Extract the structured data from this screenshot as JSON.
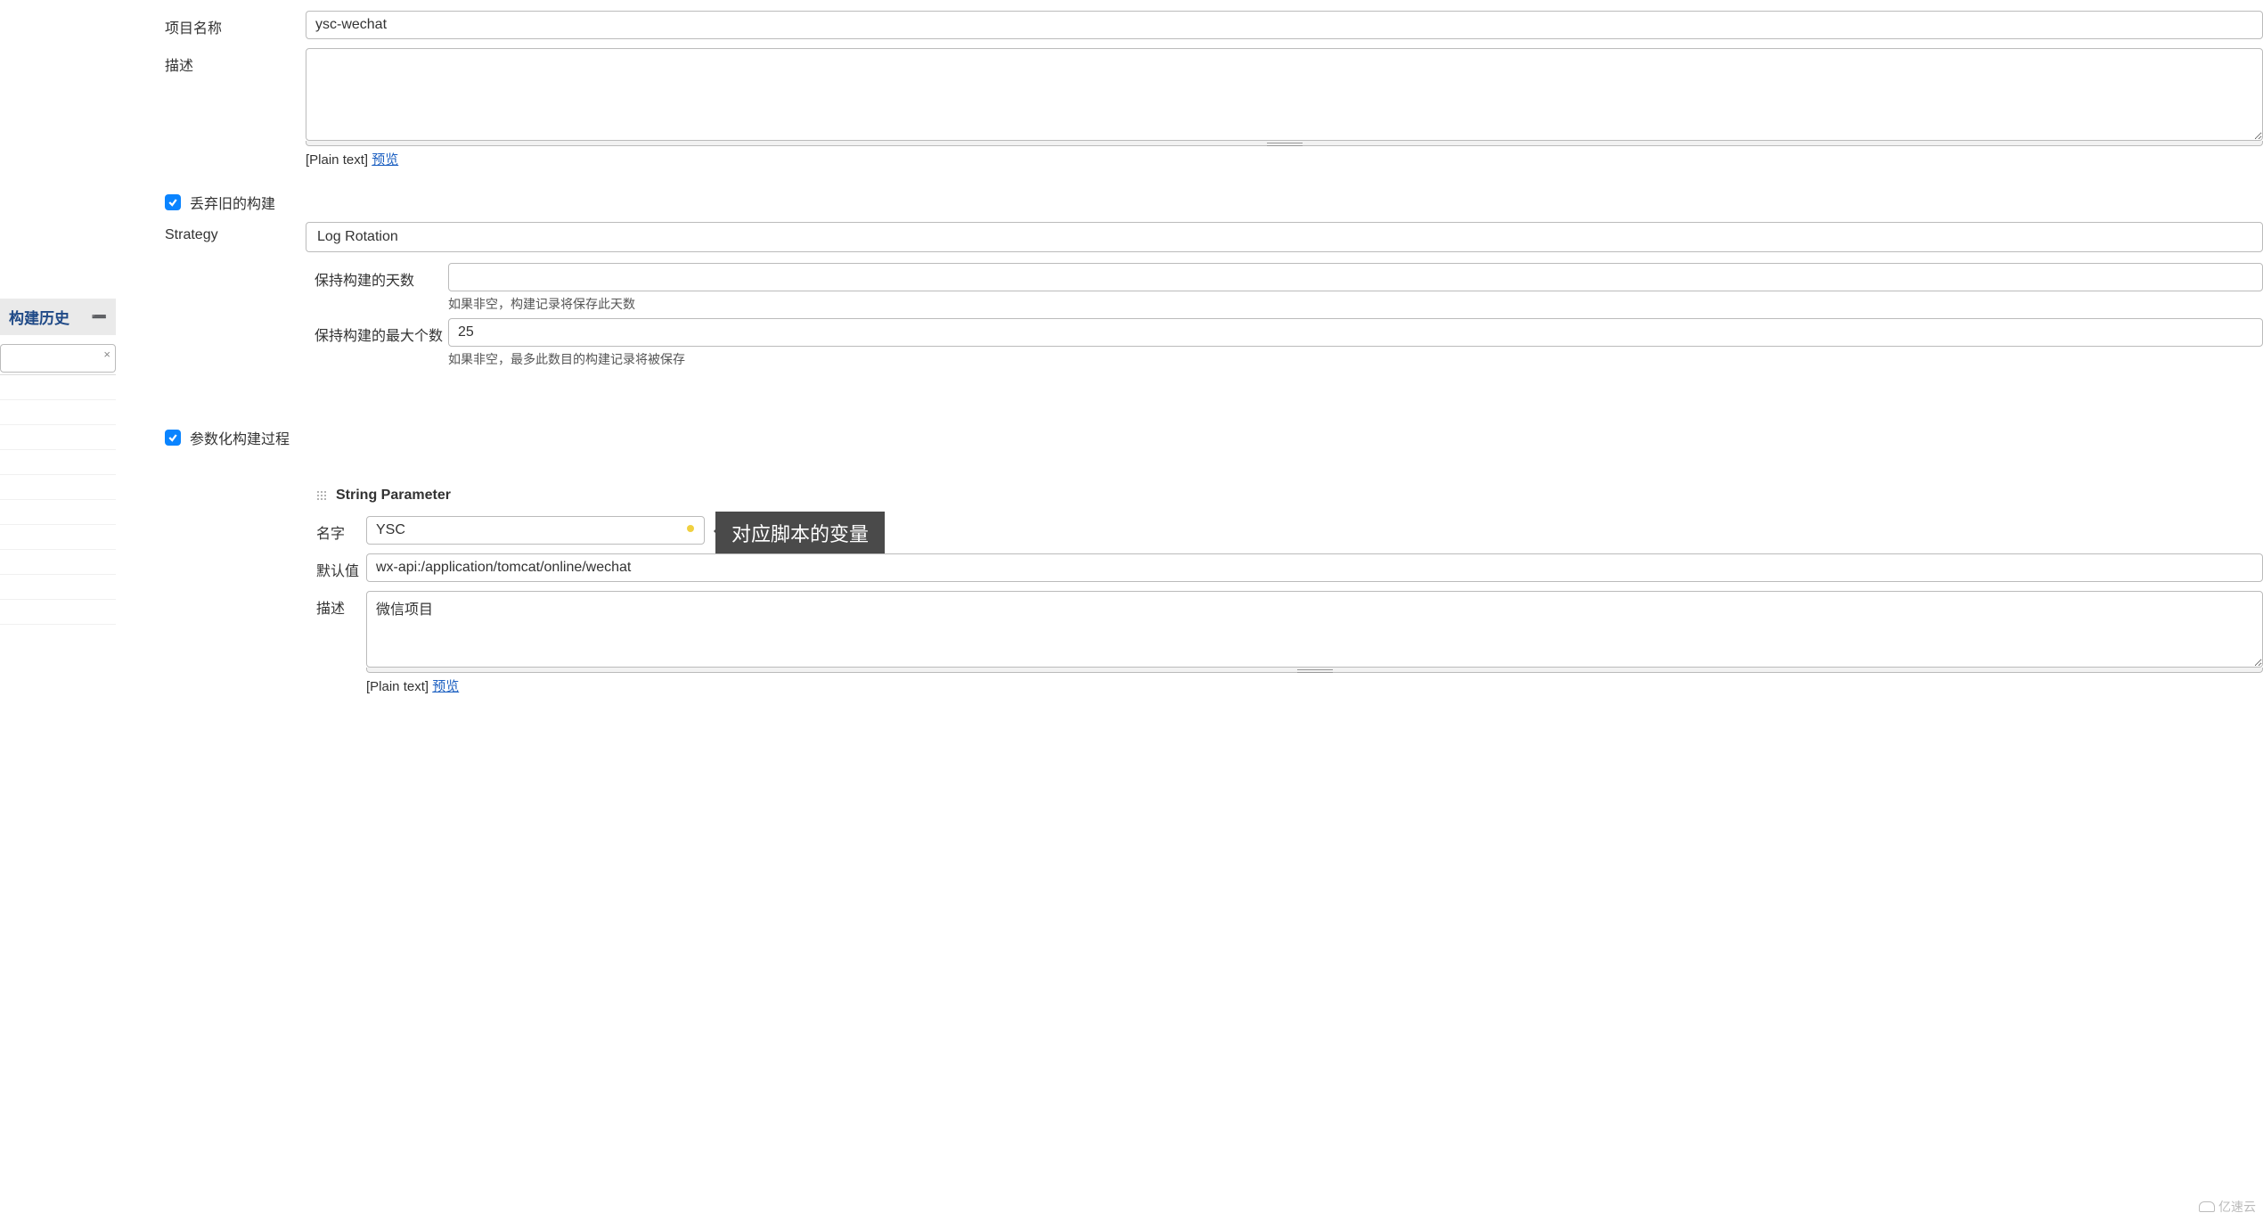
{
  "sidebar": {
    "title": "构建历史"
  },
  "form": {
    "project_name_label": "项目名称",
    "project_name_value": "ysc-wechat",
    "description_label": "描述",
    "description_value": "",
    "plain_text_label": "[Plain text]",
    "preview_label": "预览",
    "discard_old_builds": {
      "checked": true,
      "label": "丢弃旧的构建"
    },
    "strategy": {
      "label": "Strategy",
      "value": "Log Rotation",
      "days_label": "保持构建的天数",
      "days_value": "",
      "days_help": "如果非空，构建记录将保存此天数",
      "max_label": "保持构建的最大个数",
      "max_value": "25",
      "max_help": "如果非空，最多此数目的构建记录将被保存"
    },
    "parameterized": {
      "checked": true,
      "label": "参数化构建过程"
    }
  },
  "string_param": {
    "title": "String Parameter",
    "name_label": "名字",
    "name_value": "YSC",
    "tooltip": "对应脚本的变量",
    "default_label": "默认值",
    "default_value": "wx-api:/application/tomcat/online/wechat",
    "desc_label": "描述",
    "desc_value": "微信项目",
    "plain_text_label": "[Plain text]",
    "preview_label": "预览"
  },
  "watermark": "亿速云"
}
